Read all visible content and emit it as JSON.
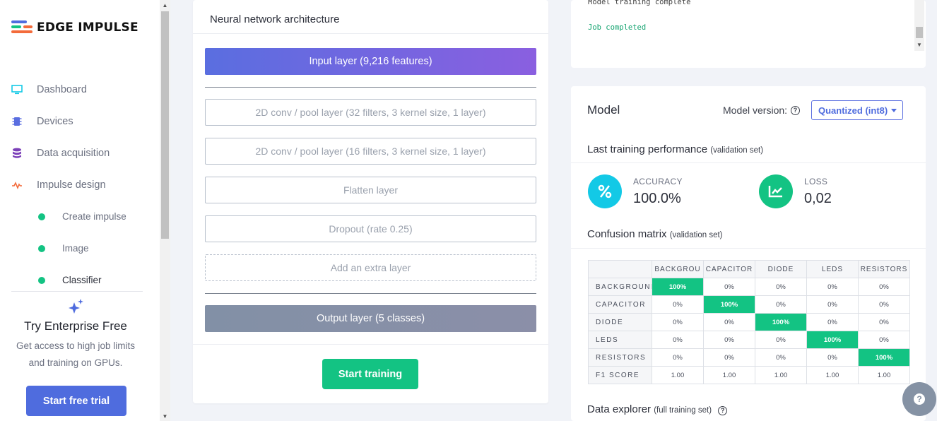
{
  "brand": {
    "name": "EDGE IMPULSE"
  },
  "sidebar": {
    "items": [
      {
        "label": "Dashboard",
        "icon": "monitor-icon"
      },
      {
        "label": "Devices",
        "icon": "chip-icon"
      },
      {
        "label": "Data acquisition",
        "icon": "database-icon"
      },
      {
        "label": "Impulse design",
        "icon": "pulse-icon"
      }
    ],
    "sub_items": [
      {
        "label": "Create impulse"
      },
      {
        "label": "Image"
      },
      {
        "label": "Classifier"
      }
    ],
    "enterprise": {
      "title": "Try Enterprise Free",
      "text": "Get access to high job limits and training on GPUs.",
      "button": "Start free trial"
    }
  },
  "nn": {
    "title": "Neural network architecture",
    "input_layer": "Input layer (9,216 features)",
    "layers": [
      "2D conv / pool layer (32 filters, 3 kernel size, 1 layer)",
      "2D conv / pool layer (16 filters, 3 kernel size, 1 layer)",
      "Flatten layer",
      "Dropout (rate 0.25)"
    ],
    "add_layer": "Add an extra layer",
    "output_layer": "Output layer (5 classes)",
    "start_button": "Start training"
  },
  "log": {
    "lines": [
      "Model training complete",
      "Job completed"
    ]
  },
  "model": {
    "title": "Model",
    "version_label": "Model version:",
    "version_value": "Quantized (int8)",
    "last_perf_title": "Last training performance",
    "last_perf_sub": "(validation set)",
    "accuracy_label": "ACCURACY",
    "accuracy_value": "100.0%",
    "loss_label": "LOSS",
    "loss_value": "0,02",
    "confusion_title": "Confusion matrix",
    "confusion_sub": "(validation set)",
    "explorer_title": "Data explorer",
    "explorer_sub": "(full training set)",
    "colors": {
      "accuracy": "#13c9e6",
      "loss": "#13c383",
      "hit": "#13c383"
    }
  },
  "confusion": {
    "columns": [
      "BACKGROU",
      "CAPACITOR",
      "DIODE",
      "LEDS",
      "RESISTORS"
    ],
    "rows": [
      {
        "label": "BACKGROUND",
        "cells": [
          "100%",
          "0%",
          "0%",
          "0%",
          "0%"
        ]
      },
      {
        "label": "CAPACITOR",
        "cells": [
          "0%",
          "100%",
          "0%",
          "0%",
          "0%"
        ]
      },
      {
        "label": "DIODE",
        "cells": [
          "0%",
          "0%",
          "100%",
          "0%",
          "0%"
        ]
      },
      {
        "label": "LEDS",
        "cells": [
          "0%",
          "0%",
          "0%",
          "100%",
          "0%"
        ]
      },
      {
        "label": "RESISTORS",
        "cells": [
          "0%",
          "0%",
          "0%",
          "0%",
          "100%"
        ]
      },
      {
        "label": "F1 SCORE",
        "cells": [
          "1.00",
          "1.00",
          "1.00",
          "1.00",
          "1.00"
        ]
      }
    ]
  }
}
